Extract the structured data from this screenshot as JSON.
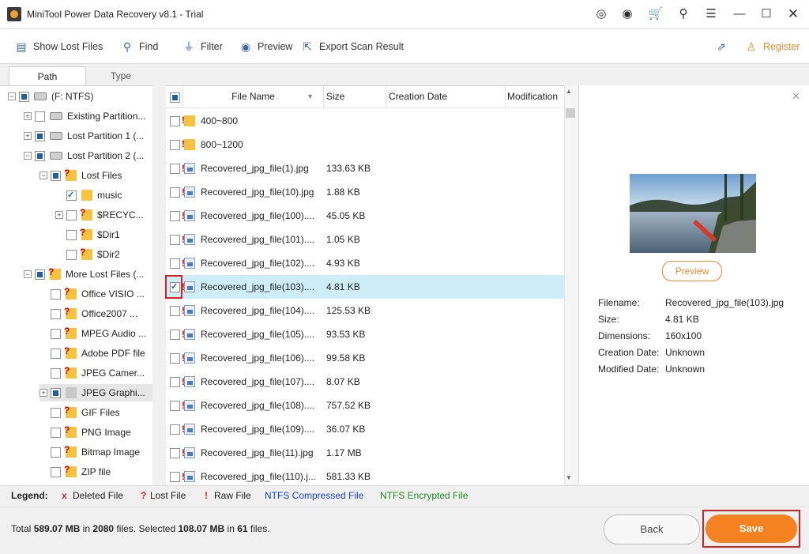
{
  "window": {
    "title": "MiniTool Power Data Recovery v8.1 - Trial",
    "controls": [
      "help-icon",
      "support-icon",
      "cart-icon",
      "search-icon",
      "menu-icon",
      "minimize-icon",
      "maximize-icon",
      "close-icon"
    ]
  },
  "toolbar": {
    "show_lost_files": "Show Lost Files",
    "find": "Find",
    "filter": "Filter",
    "preview": "Preview",
    "export": "Export Scan Result",
    "register": "Register"
  },
  "tabs": {
    "path": "Path",
    "type": "Type"
  },
  "tree": [
    {
      "label": "(F: NTFS)",
      "state": "partial",
      "icon": "drive"
    },
    {
      "label": "Existing Partition...",
      "state": "none",
      "icon": "drive"
    },
    {
      "label": "Lost Partition 1 (...",
      "state": "partial",
      "icon": "drive"
    },
    {
      "label": "Lost Partition 2 (...",
      "state": "partial",
      "icon": "drive"
    },
    {
      "label": "Lost Files",
      "state": "partial",
      "icon": "folder-lost"
    },
    {
      "label": "music",
      "state": "checked",
      "icon": "folder"
    },
    {
      "label": "$RECYC...",
      "state": "none",
      "icon": "folder-lost"
    },
    {
      "label": "$Dir1",
      "state": "none",
      "icon": "folder-lost"
    },
    {
      "label": "$Dir2",
      "state": "none",
      "icon": "folder-lost"
    },
    {
      "label": "More Lost Files (...",
      "state": "partial",
      "icon": "folder-lost"
    },
    {
      "label": "Office VISIO ...",
      "state": "none",
      "icon": "folder-lost"
    },
    {
      "label": "Office2007 ...",
      "state": "none",
      "icon": "folder-lost"
    },
    {
      "label": "MPEG Audio ...",
      "state": "none",
      "icon": "folder-lost"
    },
    {
      "label": "Adobe PDF file",
      "state": "none",
      "icon": "folder-lost"
    },
    {
      "label": "JPEG Camer...",
      "state": "none",
      "icon": "folder-lost"
    },
    {
      "label": "JPEG Graphi...",
      "state": "partial",
      "icon": "folder-gray"
    },
    {
      "label": "GIF Files",
      "state": "none",
      "icon": "folder-lost"
    },
    {
      "label": "PNG Image",
      "state": "none",
      "icon": "folder-lost"
    },
    {
      "label": "Bitmap Image",
      "state": "none",
      "icon": "folder-lost"
    },
    {
      "label": "ZIP file",
      "state": "none",
      "icon": "folder-lost"
    }
  ],
  "columns": {
    "name": "File Name",
    "size": "Size",
    "created": "Creation Date",
    "modified": "Modification"
  },
  "files": [
    {
      "name": "400~800",
      "size": "",
      "type": "folder",
      "checked": false
    },
    {
      "name": "800~1200",
      "size": "",
      "type": "folder",
      "checked": false
    },
    {
      "name": "Recovered_jpg_file(1).jpg",
      "size": "133.63 KB",
      "type": "image",
      "checked": false
    },
    {
      "name": "Recovered_jpg_file(10).jpg",
      "size": "1.88 KB",
      "type": "image",
      "checked": false
    },
    {
      "name": "Recovered_jpg_file(100)....",
      "size": "45.05 KB",
      "type": "image",
      "checked": false
    },
    {
      "name": "Recovered_jpg_file(101)....",
      "size": "1.05 KB",
      "type": "image",
      "checked": false
    },
    {
      "name": "Recovered_jpg_file(102)....",
      "size": "4.93 KB",
      "type": "image",
      "checked": false
    },
    {
      "name": "Recovered_jpg_file(103)....",
      "size": "4.81 KB",
      "type": "image",
      "checked": true
    },
    {
      "name": "Recovered_jpg_file(104)....",
      "size": "125.53 KB",
      "type": "image",
      "checked": false
    },
    {
      "name": "Recovered_jpg_file(105)....",
      "size": "93.53 KB",
      "type": "image",
      "checked": false
    },
    {
      "name": "Recovered_jpg_file(106)....",
      "size": "99.58 KB",
      "type": "image",
      "checked": false
    },
    {
      "name": "Recovered_jpg_file(107)....",
      "size": "8.07 KB",
      "type": "image",
      "checked": false
    },
    {
      "name": "Recovered_jpg_file(108)....",
      "size": "757.52 KB",
      "type": "image",
      "checked": false
    },
    {
      "name": "Recovered_jpg_file(109)....",
      "size": "36.07 KB",
      "type": "image",
      "checked": false
    },
    {
      "name": "Recovered_jpg_file(11).jpg",
      "size": "1.17 MB",
      "type": "image",
      "checked": false
    },
    {
      "name": "Recovered_jpg_file(110).j...",
      "size": "581.33 KB",
      "type": "image",
      "checked": false
    }
  ],
  "preview": {
    "button": "Preview",
    "info": [
      {
        "label": "Filename:",
        "value": "Recovered_jpg_file(103).jpg"
      },
      {
        "label": "Size:",
        "value": "4.81 KB"
      },
      {
        "label": "Dimensions:",
        "value": "160x100"
      },
      {
        "label": "Creation Date:",
        "value": "Unknown"
      },
      {
        "label": "Modified Date:",
        "value": "Unknown"
      }
    ]
  },
  "legend": {
    "title": "Legend:",
    "deleted": {
      "mark": "x",
      "label": "Deleted File"
    },
    "lost": {
      "mark": "?",
      "label": "Lost File"
    },
    "raw": {
      "mark": "!",
      "label": "Raw File"
    },
    "compressed": "NTFS Compressed File",
    "encrypted": "NTFS Encrypted File",
    "colors": {
      "mark": "#e02020",
      "compressed": "#1f3fd0",
      "encrypted": "#1f8f1f"
    }
  },
  "status": {
    "t1": "Total ",
    "total_size": "589.07 MB",
    "t2": " in ",
    "total_files": "2080",
    "t3": " files.  Selected ",
    "sel_size": "108.07 MB",
    "t4": " in ",
    "sel_files": "61",
    "t5": " files."
  },
  "buttons": {
    "back": "Back",
    "save": "Save"
  }
}
